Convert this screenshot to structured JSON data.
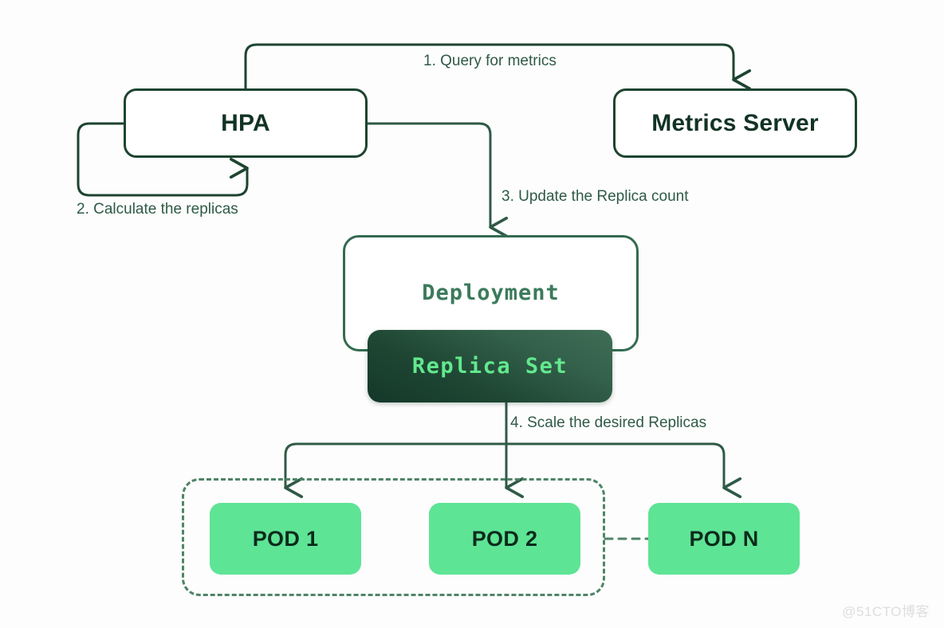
{
  "diagram": {
    "title": "Kubernetes HPA autoscaling flow",
    "colors": {
      "background": "#fdfdfd",
      "stroke_dark": "#1d4430",
      "stroke_medium": "#336b50",
      "stroke_dashed": "#4f8468",
      "label_text": "#2f5a46",
      "pod_fill": "#5ee495",
      "pod_text": "#0d2b1c",
      "replica_set_gradient_start": "#14382a",
      "replica_set_gradient_end": "#3f6d55",
      "replica_set_text": "#62e88e",
      "deployment_text": "#3c7a5b",
      "watermark": "#dedede"
    }
  },
  "nodes": {
    "hpa": {
      "label": "HPA"
    },
    "metrics_server": {
      "label": "Metrics Server"
    },
    "deployment": {
      "label": "Deployment"
    },
    "replica_set": {
      "label": "Replica Set"
    },
    "pods": [
      {
        "label": "POD 1"
      },
      {
        "label": "POD 2"
      },
      {
        "label": "POD N"
      }
    ]
  },
  "steps": [
    {
      "id": "step-1",
      "label": "1.  Query for metrics"
    },
    {
      "id": "step-2",
      "label": "2. Calculate the replicas"
    },
    {
      "id": "step-3",
      "label": "3. Update the Replica count"
    },
    {
      "id": "step-4",
      "label": "4. Scale the desired Replicas"
    }
  ],
  "watermark": {
    "text": "@51CTO博客"
  }
}
